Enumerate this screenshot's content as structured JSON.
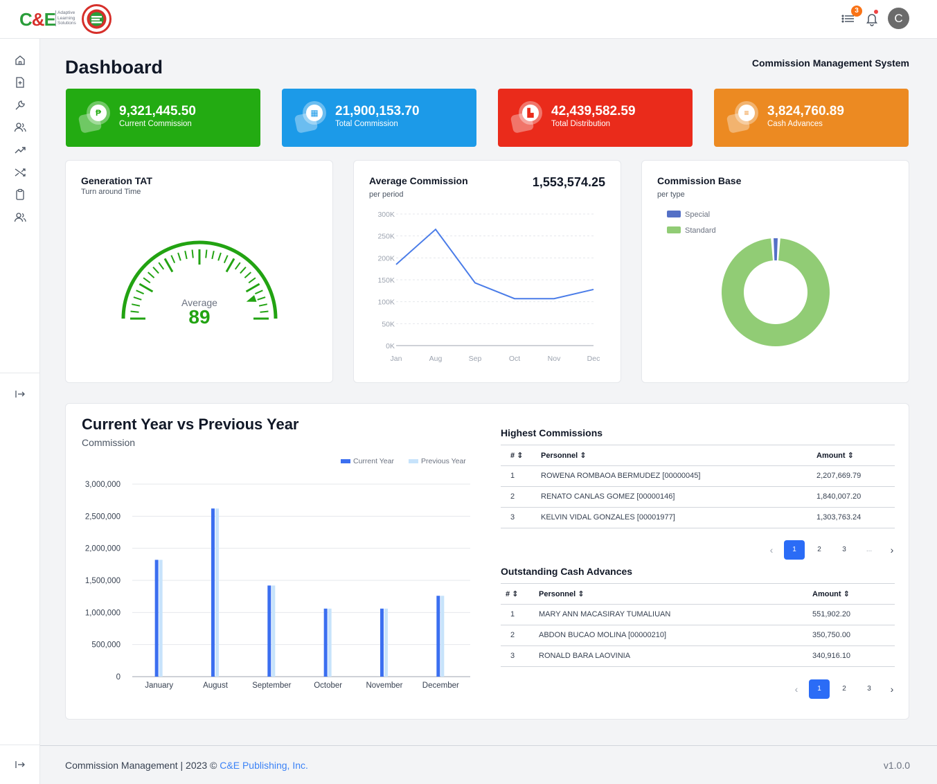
{
  "header": {
    "logo_text": "C&E",
    "logo_sub": [
      "Adaptive",
      "Learning",
      "Solutions"
    ],
    "notification_count": "3",
    "avatar_initial": "C"
  },
  "page": {
    "title": "Dashboard",
    "subtitle": "Commission Management System"
  },
  "stats": [
    {
      "value": "9,321,445.50",
      "label": "Current Commission",
      "color": "#23ab12",
      "icon": "peso-icon"
    },
    {
      "value": "21,900,153.70",
      "label": "Total Commission",
      "color": "#1c9ae8",
      "icon": "calendar-icon"
    },
    {
      "value": "42,439,582.59",
      "label": "Total Distribution",
      "color": "#ea2b1b",
      "icon": "chart-icon"
    },
    {
      "value": "3,824,760.89",
      "label": "Cash Advances",
      "color": "#ec8a22",
      "icon": "cash-icon"
    }
  ],
  "gauge": {
    "title": "Generation TAT",
    "subtitle": "Turn around Time",
    "label": "Average",
    "value": "89",
    "fraction": 0.89
  },
  "avg_commission": {
    "title": "Average Commission",
    "subtitle": "per period",
    "total": "1,553,574.25"
  },
  "commission_base": {
    "title": "Commission Base",
    "subtitle": "per type"
  },
  "cy_py": {
    "title": "Current Year vs Previous Year",
    "subtitle": "Commission"
  },
  "highest": {
    "title": "Highest Commissions",
    "headers": [
      "#",
      "Personnel",
      "Amount"
    ],
    "rows": [
      {
        "no": "1",
        "name": "ROWENA ROMBAOA BERMUDEZ [00000045]",
        "amount": "2,207,669.79"
      },
      {
        "no": "2",
        "name": "RENATO CANLAS GOMEZ [00000146]",
        "amount": "1,840,007.20"
      },
      {
        "no": "3",
        "name": "KELVIN VIDAL GONZALES [00001977]",
        "amount": "1,303,763.24"
      }
    ],
    "pages": [
      "1",
      "2",
      "3",
      "..."
    ]
  },
  "outstanding": {
    "title": "Outstanding Cash Advances",
    "headers": [
      "#",
      "Personnel",
      "Amount"
    ],
    "rows": [
      {
        "no": "1",
        "name": "MARY ANN MACASIRAY TUMALIUAN",
        "amount": "551,902.20"
      },
      {
        "no": "2",
        "name": "ABDON BUCAO MOLINA [00000210]",
        "amount": "350,750.00"
      },
      {
        "no": "3",
        "name": "RONALD BARA LAOVINIA",
        "amount": "340,916.10"
      }
    ],
    "pages": [
      "1",
      "2",
      "3"
    ]
  },
  "footer": {
    "text": "Commission Management | 2023 © ",
    "link": "C&E Publishing, Inc.",
    "version": "v1.0.0"
  },
  "chart_data": [
    {
      "type": "line",
      "categories": [
        "Jan",
        "Aug",
        "Sep",
        "Oct",
        "Nov",
        "Dec"
      ],
      "values": [
        185000,
        265000,
        143000,
        107000,
        107000,
        128000
      ],
      "ylim": [
        0,
        300000
      ],
      "yticks": [
        "0K",
        "50K",
        "100K",
        "150K",
        "200K",
        "250K",
        "300K"
      ],
      "color": "#4a7ce8"
    },
    {
      "type": "pie",
      "legend": [
        "Special",
        "Standard"
      ],
      "values": [
        2,
        98
      ],
      "colors": [
        "#5470c6",
        "#91cc75"
      ]
    },
    {
      "type": "bar",
      "categories": [
        "January",
        "August",
        "September",
        "October",
        "November",
        "December"
      ],
      "series": [
        {
          "name": "Current Year",
          "values": [
            1820000,
            2620000,
            1420000,
            1060000,
            1060000,
            1260000
          ],
          "color": "#3b6ff0"
        },
        {
          "name": "Previous Year",
          "values": [
            1820000,
            2620000,
            1420000,
            1060000,
            1060000,
            1260000
          ],
          "color": "#c7e3fb"
        }
      ],
      "ylim": [
        0,
        3000000
      ],
      "yticks": [
        "0",
        "500,000",
        "1,000,000",
        "1,500,000",
        "2,000,000",
        "2,500,000",
        "3,000,000"
      ]
    }
  ]
}
